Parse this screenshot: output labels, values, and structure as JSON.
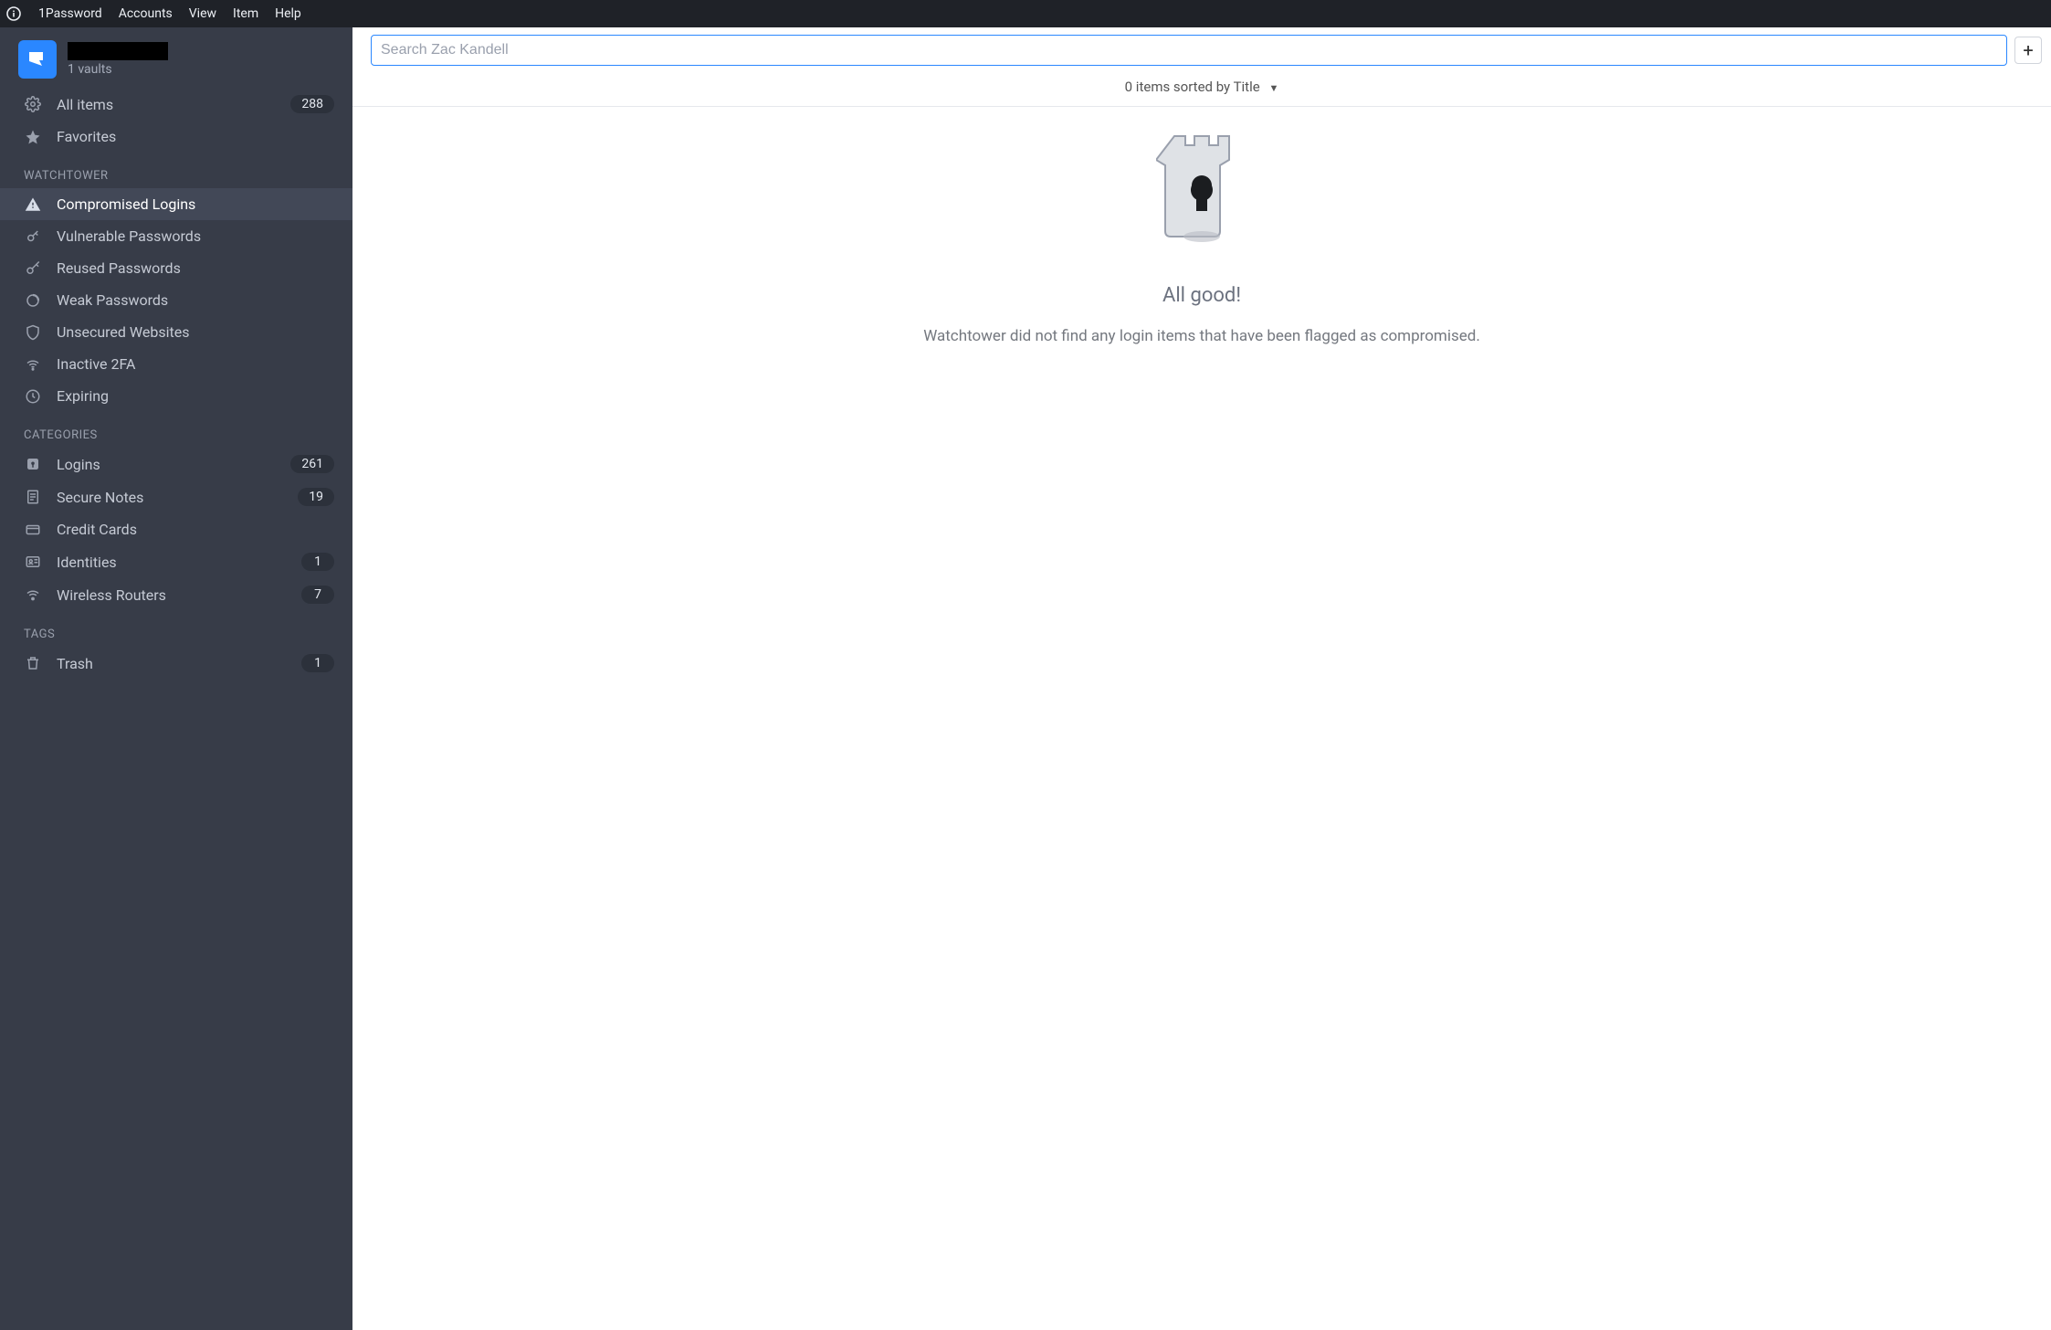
{
  "menubar": {
    "app": "1Password",
    "items": [
      "Accounts",
      "View",
      "Item",
      "Help"
    ]
  },
  "account": {
    "vaults_label": "1 vaults"
  },
  "sidebar": {
    "top": [
      {
        "icon": "settings",
        "label": "All items",
        "count": "288"
      },
      {
        "icon": "star",
        "label": "Favorites",
        "count": ""
      }
    ],
    "watchtower_header": "WATCHTOWER",
    "watchtower": [
      {
        "icon": "alert",
        "label": "Compromised Logins",
        "active": true
      },
      {
        "icon": "vuln",
        "label": "Vulnerable Passwords"
      },
      {
        "icon": "key",
        "label": "Reused Passwords"
      },
      {
        "icon": "circle",
        "label": "Weak Passwords"
      },
      {
        "icon": "shield",
        "label": "Unsecured Websites"
      },
      {
        "icon": "wifi",
        "label": "Inactive 2FA"
      },
      {
        "icon": "clock",
        "label": "Expiring"
      }
    ],
    "categories_header": "CATEGORIES",
    "categories": [
      {
        "icon": "lock",
        "label": "Logins",
        "count": "261"
      },
      {
        "icon": "note",
        "label": "Secure Notes",
        "count": "19"
      },
      {
        "icon": "card",
        "label": "Credit Cards",
        "count": ""
      },
      {
        "icon": "id",
        "label": "Identities",
        "count": "1"
      },
      {
        "icon": "router",
        "label": "Wireless Routers",
        "count": "7"
      }
    ],
    "tags_header": "TAGS",
    "trash": {
      "icon": "trash",
      "label": "Trash",
      "count": "1"
    }
  },
  "content": {
    "search_placeholder": "Search Zac Kandell",
    "sort_text": "0 items sorted by Title",
    "empty_title": "All good!",
    "empty_sub": "Watchtower did not find any login items that have been flagged as compromised."
  }
}
